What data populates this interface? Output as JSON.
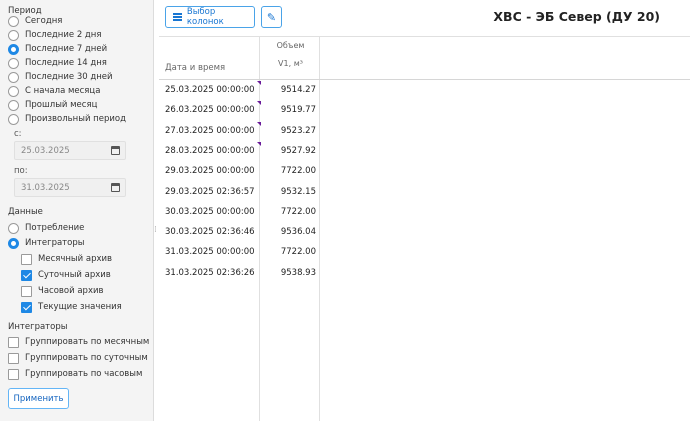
{
  "sidebar": {
    "period_title": "Период",
    "period_options": [
      {
        "label": "Сегодня",
        "selected": false
      },
      {
        "label": "Последние 2 дня",
        "selected": false
      },
      {
        "label": "Последние 7 дней",
        "selected": true
      },
      {
        "label": "Последние 14 дня",
        "selected": false
      },
      {
        "label": "Последние 30 дней",
        "selected": false
      },
      {
        "label": "С начала месяца",
        "selected": false
      },
      {
        "label": "Прошлый месяц",
        "selected": false
      },
      {
        "label": "Произвольный период",
        "selected": false
      }
    ],
    "from_label": "с:",
    "from_value": "25.03.2025",
    "to_label": "по:",
    "to_value": "31.03.2025",
    "data_title": "Данные",
    "data_options": [
      {
        "label": "Потребление",
        "selected": false
      },
      {
        "label": "Интеграторы",
        "selected": true
      }
    ],
    "archives": [
      {
        "label": "Месячный архив",
        "checked": false
      },
      {
        "label": "Суточный архив",
        "checked": true
      },
      {
        "label": "Часовой архив",
        "checked": false
      },
      {
        "label": "Текущие значения",
        "checked": true
      }
    ],
    "integrators_title": "Интеграторы",
    "grouping": [
      {
        "label": "Группировать по месячным",
        "checked": false
      },
      {
        "label": "Группировать по суточным",
        "checked": false
      },
      {
        "label": "Группировать по часовым",
        "checked": false
      }
    ],
    "apply_label": "Применить"
  },
  "toolbar": {
    "columns_label": "Выбор колонок",
    "columns_icon": "list-icon",
    "edit_icon": "pencil-icon",
    "title": "ХВС - ЭБ Север (ДУ 20)"
  },
  "table": {
    "col_date": "Дата и время",
    "col_vol_group": "Объем",
    "col_vol": "V1, м³",
    "rows": [
      {
        "date": "25.03.2025 00:00:00",
        "value": "9514.27"
      },
      {
        "date": "26.03.2025 00:00:00",
        "value": "9519.77"
      },
      {
        "date": "27.03.2025 00:00:00",
        "value": "9523.27"
      },
      {
        "date": "28.03.2025 00:00:00",
        "value": "9527.92"
      },
      {
        "date": "29.03.2025 00:00:00",
        "value": "7722.00"
      },
      {
        "date": "29.03.2025 02:36:57",
        "value": "9532.15"
      },
      {
        "date": "30.03.2025 00:00:00",
        "value": "7722.00"
      },
      {
        "date": "30.03.2025 02:36:46",
        "value": "9536.04"
      },
      {
        "date": "31.03.2025 00:00:00",
        "value": "7722.00"
      },
      {
        "date": "31.03.2025 02:36:26",
        "value": "9538.93"
      }
    ]
  },
  "colors": {
    "accent": "#1e88e5",
    "marker": "#6a1b9a"
  }
}
